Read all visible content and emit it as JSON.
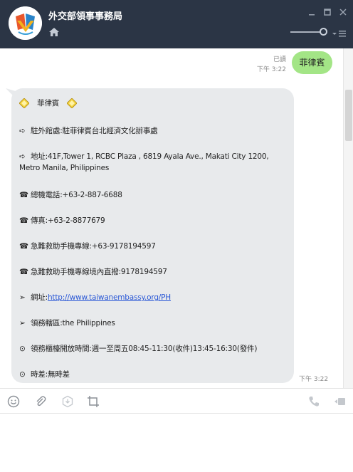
{
  "window": {
    "title": "外交部領事事務局"
  },
  "chat": {
    "sent": {
      "read_label": "已讀",
      "time": "下午 3:22",
      "text": "菲律賓"
    },
    "received": {
      "time": "下午 3:22",
      "lines": [
        {
          "glyph": "",
          "text": "菲律賓",
          "icon": "diamond-sparkle"
        },
        {
          "glyph": "➪",
          "text": "駐外館處:駐菲律賓台北經濟文化辦事處"
        },
        {
          "glyph": "➪",
          "text": "地址:41F,Tower 1, RCBC Plaza , 6819 Ayala Ave., Makati City 1200,"
        },
        {
          "glyph": "",
          "text": "Metro Manila, Philippines"
        },
        {
          "glyph": "☎",
          "text": "總機電話:+63-2-887-6688"
        },
        {
          "glyph": "☎",
          "text": "傳真:+63-2-8877679"
        },
        {
          "glyph": "☎",
          "text": "急難救助手機專線:+63-9178194597"
        },
        {
          "glyph": "☎",
          "text": "急難救助手機專線境內直撥:9178194597"
        },
        {
          "glyph": "➢",
          "text_prefix": "網址:",
          "link": "http://www.taiwanembassy.org/PH"
        },
        {
          "glyph": "➢",
          "text": "領務轄區:the Philippines"
        },
        {
          "glyph": "⊙",
          "text": "領務櫃檯開放時間:週一至周五08:45-11:30(收件)13:45-16:30(發件)"
        },
        {
          "glyph": "⊙",
          "text": "時差:無時差"
        }
      ]
    }
  },
  "toolbar": {
    "icons": [
      "emoji-icon",
      "attach-icon",
      "download-icon",
      "crop-icon",
      "call-icon",
      "video-icon"
    ]
  },
  "input": {
    "placeholder": ""
  },
  "colors": {
    "header_bg": "#2b3545",
    "sent_bubble": "#a3e586",
    "recv_bubble": "#e8eaec",
    "link": "#2a58d6"
  }
}
